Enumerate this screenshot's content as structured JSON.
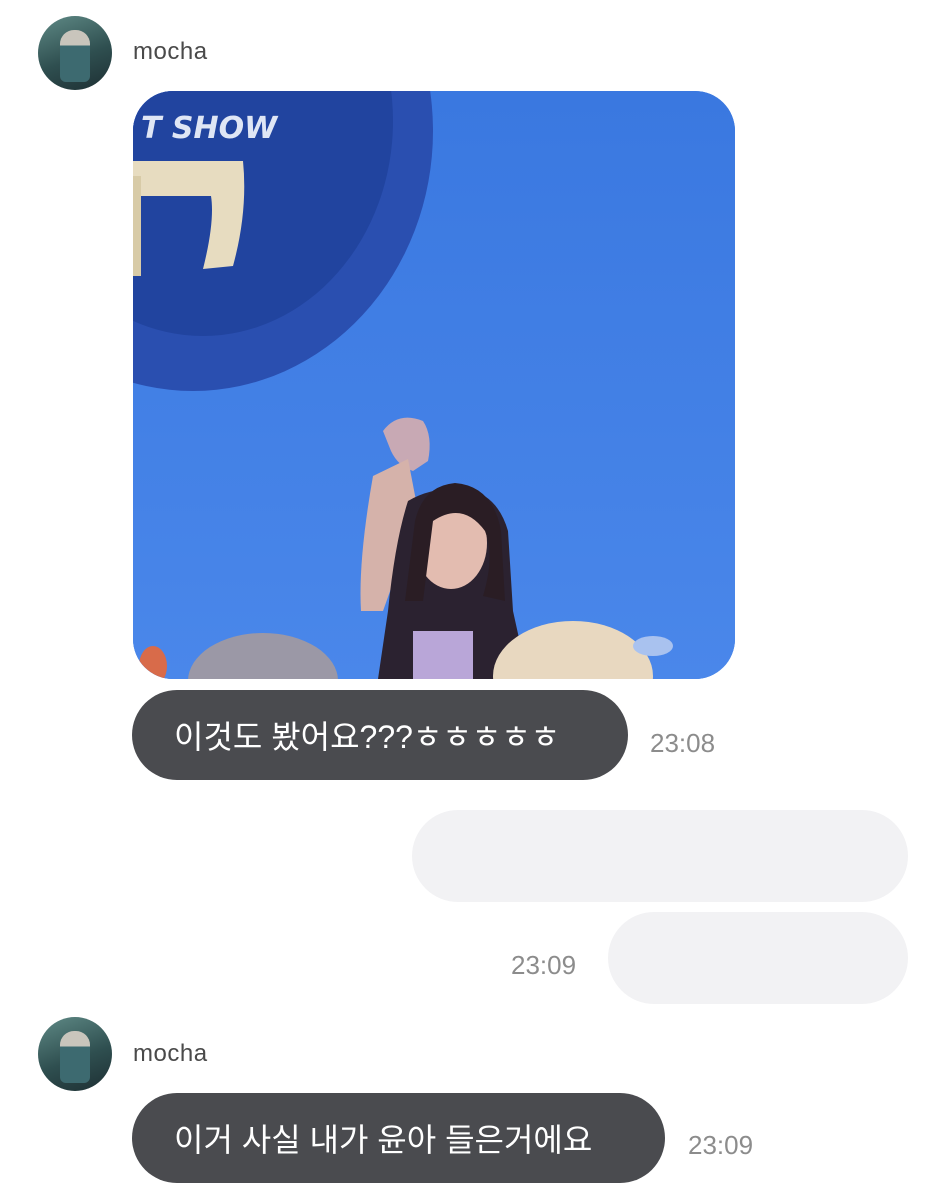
{
  "messages": {
    "first_sender": "mocha",
    "msg1_text": "이것도 봤어요???ㅎㅎㅎㅎㅎ",
    "msg1_time": "23:08",
    "out_time": "23:09",
    "second_sender": "mocha",
    "msg2_text": "이거 사실 내가 윤아 들은거에요",
    "msg2_time": "23:09"
  },
  "media": {
    "overlay_text": "T SHOW"
  }
}
